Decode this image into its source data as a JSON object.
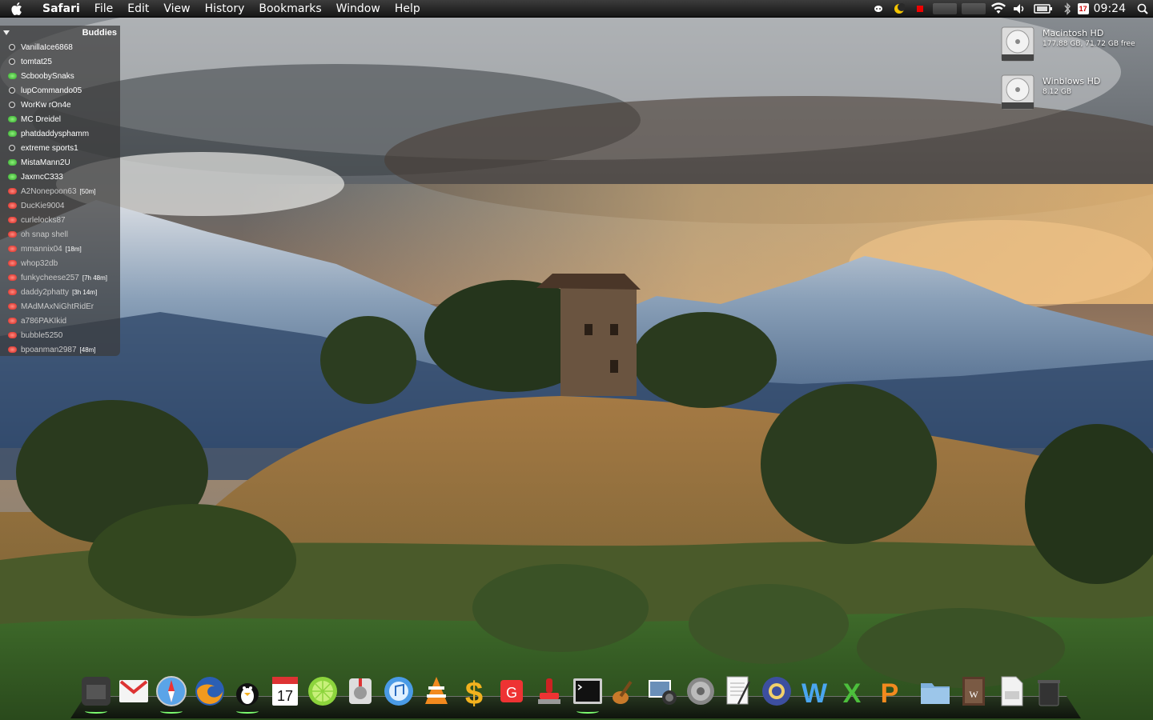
{
  "menubar": {
    "apple_icon": "apple-icon",
    "items": [
      "Safari",
      "File",
      "Edit",
      "View",
      "History",
      "Bookmarks",
      "Window",
      "Help"
    ],
    "status_icons": [
      "ichat-icon",
      "moon-icon",
      "record-icon",
      "cpu-meter",
      "network-meter",
      "wifi-icon",
      "volume-icon",
      "battery-icon",
      "bluetooth-icon",
      "calendar-icon"
    ],
    "calendar_day": "17",
    "clock": "09:24",
    "spotlight_icon": "spotlight-icon"
  },
  "buddies": {
    "title": "Buddies",
    "list": [
      {
        "name": "VanillaIce6868",
        "status": "idle",
        "time": ""
      },
      {
        "name": "tomtat25",
        "status": "idle",
        "time": ""
      },
      {
        "name": "ScboobySnaks",
        "status": "available",
        "time": ""
      },
      {
        "name": "lupCommando05",
        "status": "idle",
        "time": ""
      },
      {
        "name": "WorKw rOn4e",
        "status": "idle",
        "time": ""
      },
      {
        "name": "MC Dreidel",
        "status": "available",
        "time": ""
      },
      {
        "name": "phatdaddysphamm",
        "status": "available",
        "time": ""
      },
      {
        "name": "extreme sports1",
        "status": "idle",
        "time": ""
      },
      {
        "name": "MistaMann2U",
        "status": "available",
        "time": ""
      },
      {
        "name": "JaxmcC333",
        "status": "available",
        "time": ""
      },
      {
        "name": "A2Nonepoon63",
        "status": "away",
        "time": "[50m]"
      },
      {
        "name": "DucKie9004",
        "status": "away",
        "time": ""
      },
      {
        "name": "curlelocks87",
        "status": "away",
        "time": ""
      },
      {
        "name": "oh snap shell",
        "status": "away",
        "time": ""
      },
      {
        "name": "mmannix04",
        "status": "away",
        "time": "[18m]"
      },
      {
        "name": "whop32db",
        "status": "away",
        "time": ""
      },
      {
        "name": "funkycheese257",
        "status": "away",
        "time": "[7h 48m]"
      },
      {
        "name": "daddy2phatty",
        "status": "away",
        "time": "[3h 14m]"
      },
      {
        "name": "MAdMAxNiGhtRidEr",
        "status": "away",
        "time": ""
      },
      {
        "name": "a786PAKIkid",
        "status": "away",
        "time": ""
      },
      {
        "name": "bubble5250",
        "status": "away",
        "time": ""
      },
      {
        "name": "bpoanman2987",
        "status": "away",
        "time": "[48m]"
      }
    ]
  },
  "disks": [
    {
      "name": "Macintosh HD",
      "info": "177.88 GB, 71.72 GB free"
    },
    {
      "name": "Winblows HD",
      "info": "8.12 GB"
    }
  ],
  "dock": {
    "items": [
      {
        "name": "finder-icon",
        "running": true
      },
      {
        "name": "gmail-icon",
        "running": false
      },
      {
        "name": "safari-icon",
        "running": true
      },
      {
        "name": "firefox-icon",
        "running": false
      },
      {
        "name": "adium-icon",
        "running": true
      },
      {
        "name": "ical-icon",
        "running": false
      },
      {
        "name": "limewire-icon",
        "running": false
      },
      {
        "name": "transmission-icon",
        "running": false
      },
      {
        "name": "itunes-icon",
        "running": false
      },
      {
        "name": "vlc-icon",
        "running": false
      },
      {
        "name": "money-icon",
        "running": false
      },
      {
        "name": "clipping-icon",
        "running": false
      },
      {
        "name": "stamp-icon",
        "running": false
      },
      {
        "name": "terminal-icon",
        "running": true
      },
      {
        "name": "garageband-icon",
        "running": false
      },
      {
        "name": "iphoto-icon",
        "running": false
      },
      {
        "name": "system-preferences-icon",
        "running": false
      },
      {
        "name": "textedit-icon",
        "running": false
      },
      {
        "name": "camino-icon",
        "running": false
      },
      {
        "name": "iweb-icon",
        "running": false
      },
      {
        "name": "excel-icon",
        "running": false
      },
      {
        "name": "powerpoint-icon",
        "running": false
      },
      {
        "name": "documents-folder-icon",
        "running": false
      },
      {
        "name": "word-document-icon",
        "running": false
      },
      {
        "name": "file-icon",
        "running": false
      },
      {
        "name": "trash-icon",
        "running": false
      }
    ]
  },
  "colors": {
    "menubar": "#1e1e1e",
    "available": "#2fa52a",
    "away": "#d5231c",
    "running_indicator": "#7dff70"
  }
}
